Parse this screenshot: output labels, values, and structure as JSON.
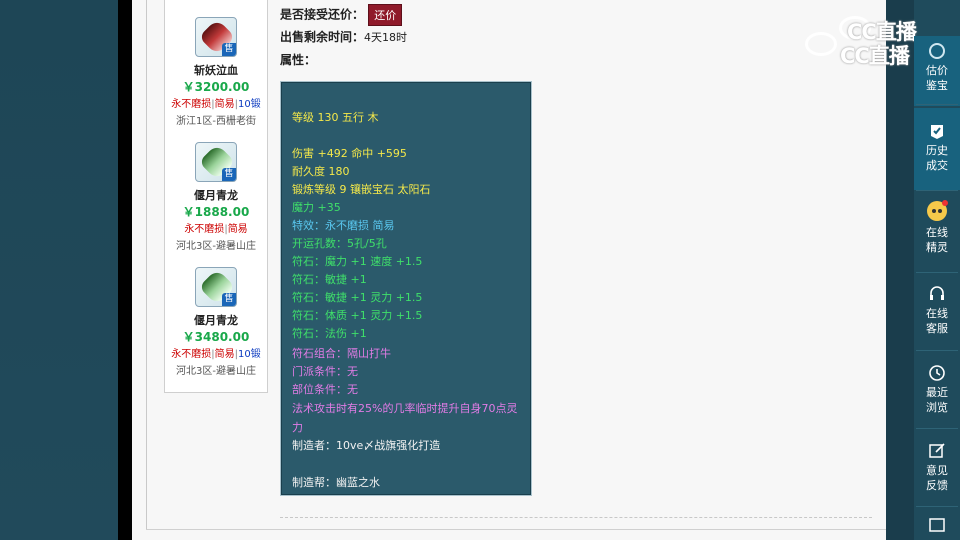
{
  "recommendations": [
    {
      "name": "斩妖泣血",
      "price": "￥3200.00",
      "tag1": "永不磨损",
      "tag2": "简易",
      "tag3": "10锻",
      "server": "浙江1区-西栅老街",
      "blade": "red"
    },
    {
      "name": "偃月青龙",
      "price": "￥1888.00",
      "tag1": "永不磨损",
      "tag2": "简易",
      "tag3": "",
      "server": "河北3区-避暑山庄",
      "blade": "green"
    },
    {
      "name": "偃月青龙",
      "price": "￥3480.00",
      "tag1": "永不磨损",
      "tag2": "简易",
      "tag3": "10锻",
      "server": "河北3区-避暑山庄",
      "blade": "green"
    }
  ],
  "sell_badge": "售",
  "info": {
    "accept_counter_label": "是否接受还价：",
    "counter_button": "还价",
    "remaining_label": "出售剩余时间：",
    "remaining_value": "4天18时",
    "attributes_label": "属性："
  },
  "attributes": [
    {
      "text": "等级 130 五行 木",
      "color": "yellow"
    },
    {
      "text": "伤害 +492 命中 +595",
      "color": "yellow"
    },
    {
      "text": "耐久度 180",
      "color": "yellow"
    },
    {
      "text": "锻炼等级 9 镶嵌宝石 太阳石",
      "color": "yellow"
    },
    {
      "text": "魔力 +35",
      "color": "green"
    },
    {
      "text": "特效：永不磨损 简易",
      "color": "cyan"
    },
    {
      "text": "开运孔数：5孔/5孔",
      "color": "green"
    },
    {
      "text": "符石：魔力 +1 速度 +1.5",
      "color": "green"
    },
    {
      "text": "符石：敏捷 +1",
      "color": "green"
    },
    {
      "text": "符石：敏捷 +1 灵力 +1.5",
      "color": "green"
    },
    {
      "text": "符石：体质 +1 灵力 +1.5",
      "color": "green"
    },
    {
      "text": "符石：法伤 +1",
      "color": "green"
    },
    {
      "text": "符石组合：隔山打牛",
      "color": "pink"
    },
    {
      "text": "门派条件：无",
      "color": "pink"
    },
    {
      "text": "部位条件：无",
      "color": "pink"
    },
    {
      "text": "法术攻击时有25%的几率临时提升自身70点灵",
      "color": "pink"
    },
    {
      "text": "力",
      "color": "pink"
    },
    {
      "text": "制造者：10ve〆战旗强化打造",
      "color": "white"
    },
    {
      "text": "制造帮：幽蓝之水",
      "color": "white"
    }
  ],
  "watermark": "CC直播",
  "sidebar": [
    {
      "label1": "估价",
      "label2": "鉴宝",
      "icon": "appraise-icon"
    },
    {
      "label1": "历史",
      "label2": "成交",
      "icon": "history-icon"
    },
    {
      "label1": "在线",
      "label2": "精灵",
      "icon": "sprite-avatar-icon"
    },
    {
      "label1": "在线",
      "label2": "客服",
      "icon": "headset-icon"
    },
    {
      "label1": "最近",
      "label2": "浏览",
      "icon": "clock-icon"
    },
    {
      "label1": "意见",
      "label2": "反馈",
      "icon": "edit-icon"
    }
  ]
}
